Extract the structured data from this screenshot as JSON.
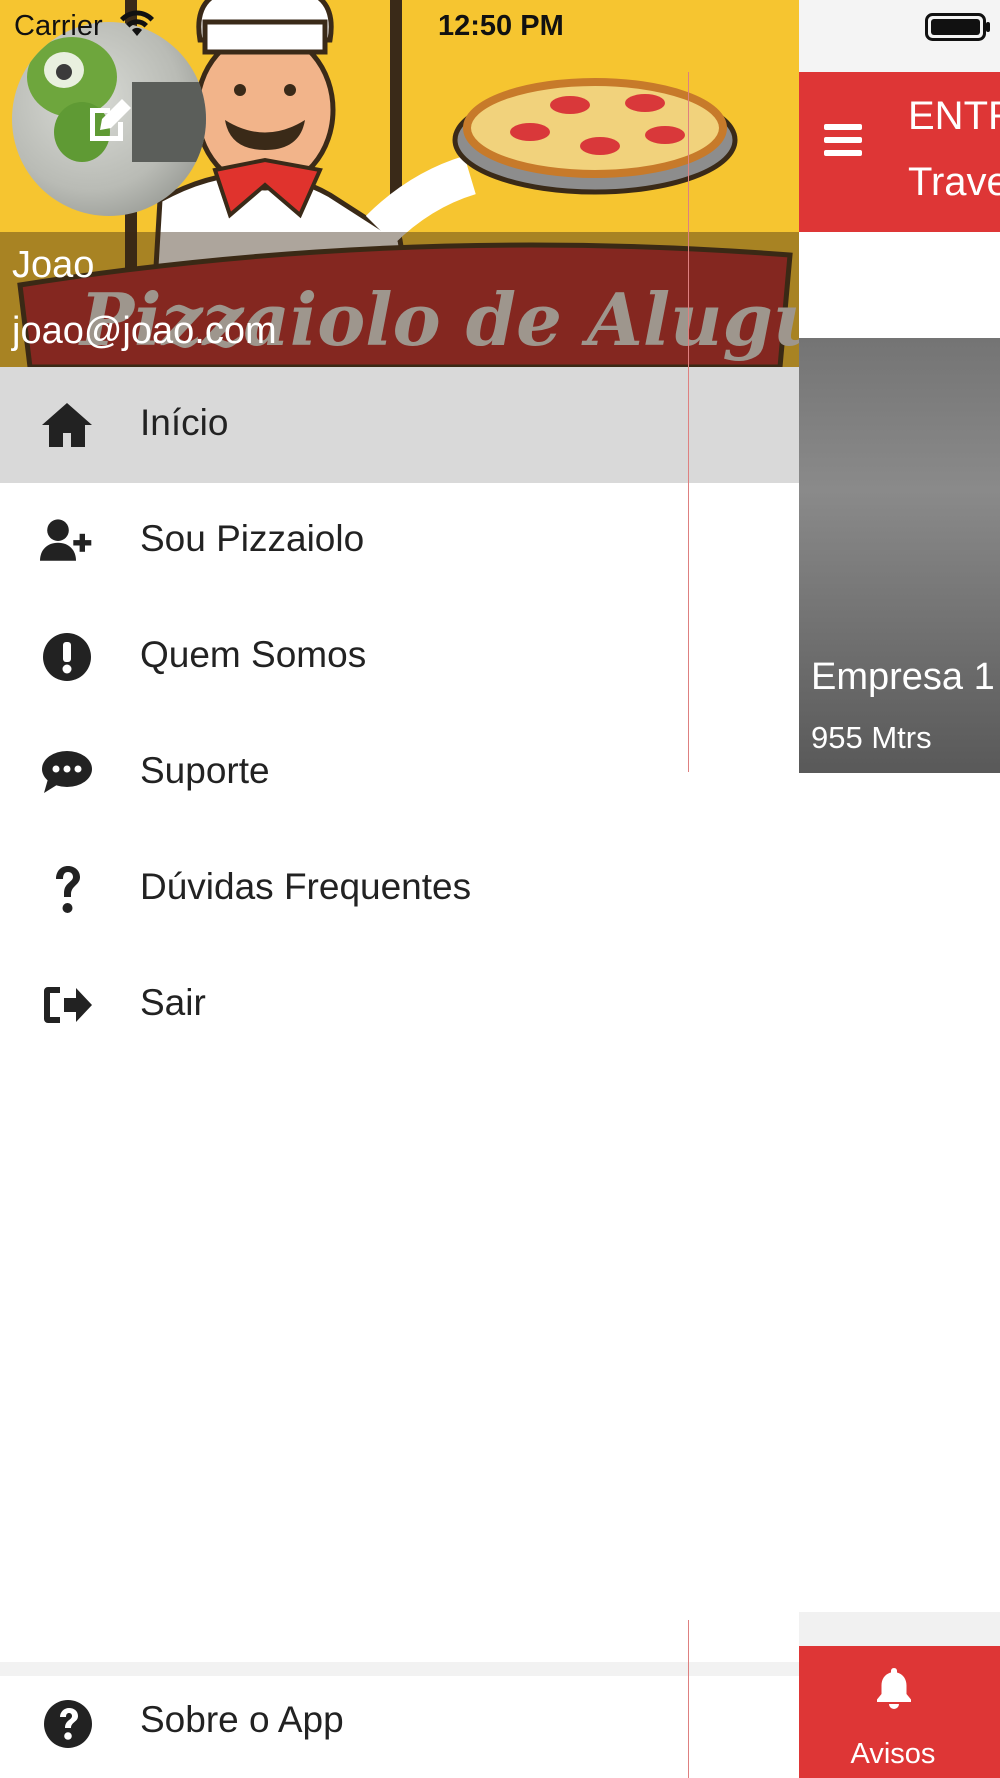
{
  "status_bar": {
    "carrier": "Carrier",
    "time": "12:50 PM"
  },
  "background_app": {
    "title": "ENTR",
    "subtitle": "Trave",
    "card": {
      "name": "Empresa 1",
      "distance": "955 Mtrs"
    },
    "tab": {
      "label": "Avisos"
    }
  },
  "drawer": {
    "user": {
      "name": "Joao",
      "email": "joao@joao.com"
    },
    "banner_text": "Pizzaiolo de Aluguel",
    "menu": [
      {
        "label": "Início",
        "icon": "home-icon",
        "active": true
      },
      {
        "label": "Sou Pizzaiolo",
        "icon": "user-plus-icon"
      },
      {
        "label": "Quem Somos",
        "icon": "exclamation-circle-icon"
      },
      {
        "label": "Suporte",
        "icon": "chat-icon"
      },
      {
        "label": "Dúvidas Frequentes",
        "icon": "question-icon"
      },
      {
        "label": "Sair",
        "icon": "sign-out-icon"
      }
    ],
    "footer": {
      "label": "Sobre o App",
      "icon": "question-circle-icon"
    }
  },
  "colors": {
    "accent": "#de3636",
    "header_bg": "#f6c530",
    "active_row": "#d9d9d9"
  }
}
